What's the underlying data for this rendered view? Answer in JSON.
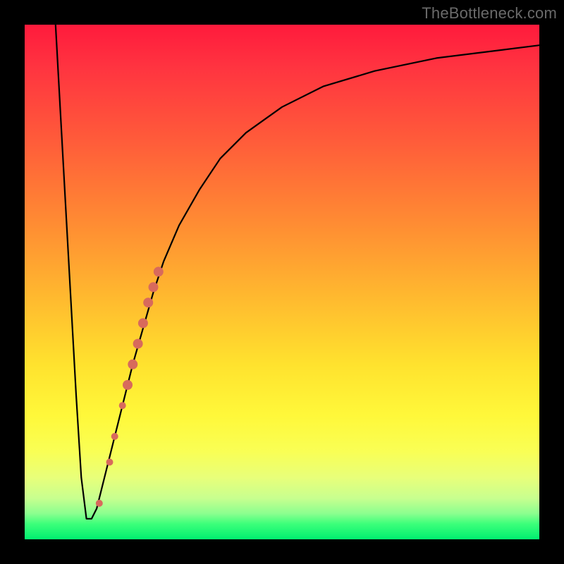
{
  "watermark": "TheBottleneck.com",
  "chart_data": {
    "type": "line",
    "title": "",
    "xlabel": "",
    "ylabel": "",
    "xlim": [
      0,
      100
    ],
    "ylim": [
      0,
      100
    ],
    "grid": false,
    "background_gradient": {
      "top": "#ff1a3c",
      "mid": "#ffe22e",
      "bottom": "#00f070"
    },
    "series": [
      {
        "name": "bottleneck-curve",
        "color": "#000000",
        "x": [
          6,
          7,
          8,
          9,
          10,
          11,
          12,
          13,
          14,
          15,
          17,
          19,
          21,
          23,
          25,
          27,
          30,
          34,
          38,
          43,
          50,
          58,
          68,
          80,
          92,
          100
        ],
        "y": [
          100,
          82,
          64,
          46,
          28,
          12,
          4,
          4,
          6,
          10,
          18,
          26,
          34,
          41,
          48,
          54,
          61,
          68,
          74,
          79,
          84,
          88,
          91,
          93.5,
          95,
          96
        ]
      }
    ],
    "markers": {
      "name": "highlight-points",
      "shape": "circle",
      "color": "#d86a5c",
      "points": [
        {
          "x": 14.5,
          "y": 7,
          "r": 5
        },
        {
          "x": 16.5,
          "y": 15,
          "r": 5
        },
        {
          "x": 17.5,
          "y": 20,
          "r": 5
        },
        {
          "x": 19,
          "y": 26,
          "r": 5
        },
        {
          "x": 20,
          "y": 30,
          "r": 7
        },
        {
          "x": 21,
          "y": 34,
          "r": 7
        },
        {
          "x": 22,
          "y": 38,
          "r": 7
        },
        {
          "x": 23,
          "y": 42,
          "r": 7
        },
        {
          "x": 24,
          "y": 46,
          "r": 7
        },
        {
          "x": 25,
          "y": 49,
          "r": 7
        },
        {
          "x": 26,
          "y": 52,
          "r": 7
        }
      ]
    }
  }
}
